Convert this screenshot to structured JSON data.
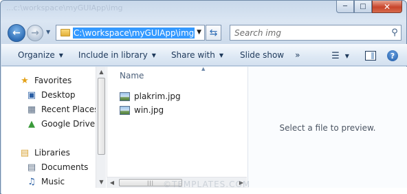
{
  "window": {
    "title_ghost": "...c:\\workspace\\myGUIApp\\img",
    "min_label": "0",
    "max_label": "1",
    "close_label": "x"
  },
  "navigation": {
    "back_icon": "back-arrow-icon",
    "forward_icon": "forward-arrow-icon",
    "address_path": "C:\\workspace\\myGUIApp\\img",
    "search_placeholder": "Search img"
  },
  "toolbar": {
    "items": [
      {
        "label": "Organize",
        "has_dropdown": true
      },
      {
        "label": "Include in library",
        "has_dropdown": true
      },
      {
        "label": "Share with",
        "has_dropdown": true
      },
      {
        "label": "Slide show",
        "has_dropdown": false
      }
    ],
    "more_label": "»"
  },
  "sidebar": {
    "items": [
      {
        "label": "Favorites",
        "icon": "star-icon",
        "group": true
      },
      {
        "label": "Desktop",
        "icon": "desktop-icon"
      },
      {
        "label": "Recent Places",
        "icon": "recent-places-icon"
      },
      {
        "label": "Google Drive",
        "icon": "google-drive-icon"
      },
      {
        "label": "Libraries",
        "icon": "libraries-icon",
        "group": true
      },
      {
        "label": "Documents",
        "icon": "documents-icon"
      },
      {
        "label": "Music",
        "icon": "music-icon"
      }
    ]
  },
  "files": {
    "column_header": "Name",
    "items": [
      {
        "name": "plakrim.jpg",
        "icon": "image-file-icon"
      },
      {
        "name": "win.jpg",
        "icon": "image-file-icon"
      }
    ]
  },
  "preview": {
    "message": "Select a file to preview."
  },
  "watermark": "©TEMPLATES.COM",
  "colors": {
    "selection": "#3399ff",
    "close_button": "#c8442b",
    "toolbar_text": "#1e395b"
  }
}
